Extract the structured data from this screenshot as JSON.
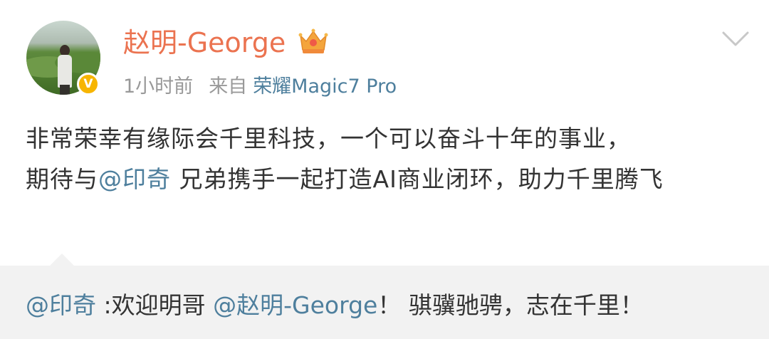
{
  "author": {
    "name": "赵明-George",
    "avatar_icon": "user-avatar-photo",
    "verified_icon": "verified-v-badge-icon",
    "verified_mark": "V",
    "member_icon": "crown-icon"
  },
  "meta": {
    "time": "1小时前",
    "from_label": "来自",
    "device": "荣耀Magic7 Pro"
  },
  "post": {
    "text_line1": "非常荣幸有缘际会千里科技，一个可以奋斗十年的事业，",
    "text_prefix": "期待与",
    "mention": "@印奇",
    "text_suffix": " 兄弟携手一起打造AI商业闭环，助力千里腾飞"
  },
  "comment": {
    "author": "@印奇",
    "text_before": " :欢迎明哥 ",
    "mention": "@赵明-George",
    "text_after": "！  骐骥驰骋，志在千里！"
  },
  "colors": {
    "username": "#eb7350",
    "link": "#4e7f9d",
    "meta": "#999999",
    "comment_bg": "#f2f2f2",
    "verified": "#f7b500"
  },
  "icons": {
    "menu": "chevron-down-icon"
  }
}
